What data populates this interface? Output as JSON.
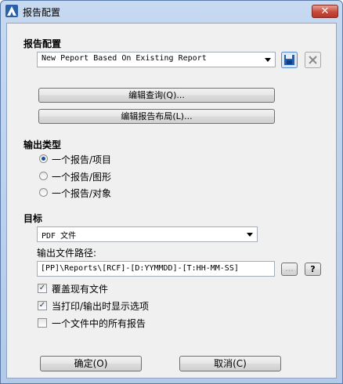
{
  "window": {
    "title": "报告配置",
    "close_label": "✕"
  },
  "report_config": {
    "section_label": "报告配置",
    "selected": "New Peport Based On Existing Report",
    "edit_query_label": "编辑查询(Q)...",
    "edit_layout_label": "编辑报告布局(L)..."
  },
  "output_type": {
    "section_label": "输出类型",
    "options": [
      {
        "label": "一个报告/项目",
        "checked": true
      },
      {
        "label": "一个报告/图形",
        "checked": false
      },
      {
        "label": "一个报告/对象",
        "checked": false
      }
    ]
  },
  "target": {
    "section_label": "目标",
    "format_selected": "PDF 文件",
    "path_label": "输出文件路径:",
    "path_value": "[PP]\\Reports\\[RCF]-[D:YYMMDD]-[T:HH-MM-SS]",
    "browse_label": "...",
    "help_label": "?",
    "checkboxes": [
      {
        "label": "覆盖现有文件",
        "checked": true
      },
      {
        "label": "当打印/输出时显示选项",
        "checked": true
      },
      {
        "label": "一个文件中的所有报告",
        "checked": false
      }
    ]
  },
  "footer": {
    "ok_label": "确定(O)",
    "cancel_label": "取消(C)"
  },
  "colors": {
    "title_gradient_top": "#c6d9f1",
    "close_red": "#c8493a",
    "save_icon_blue": "#1f5fb5"
  }
}
